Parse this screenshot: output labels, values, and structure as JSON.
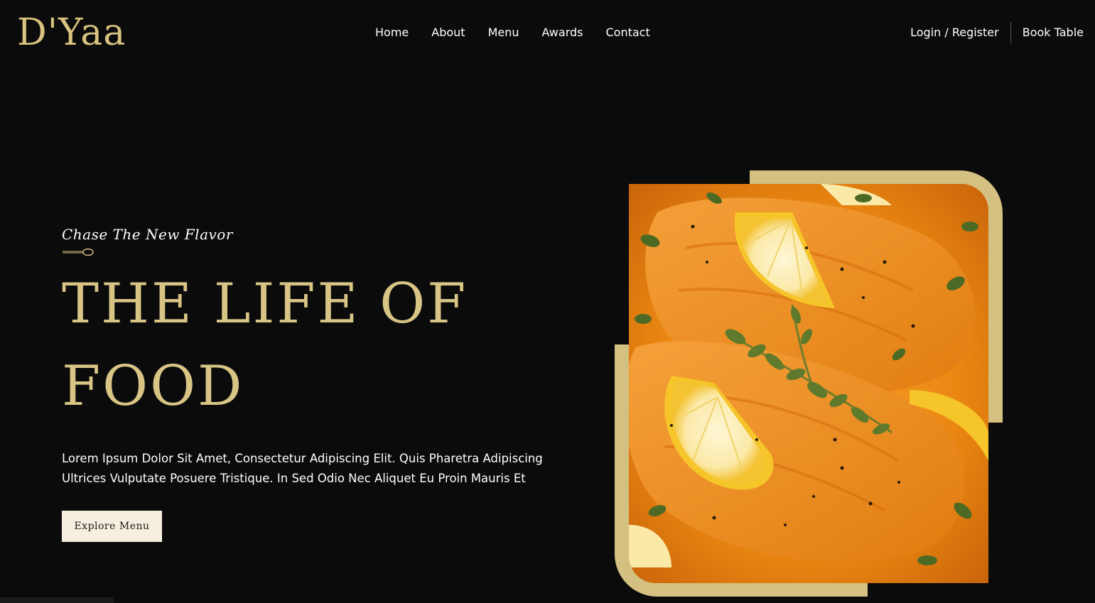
{
  "brand": {
    "logo": "D'Yaa"
  },
  "nav": {
    "items": [
      "Home",
      "About",
      "Menu",
      "Awards",
      "Contact"
    ],
    "login": "Login / Register",
    "book": "Book Table"
  },
  "hero": {
    "tagline": "Chase The New Flavor",
    "headline_line1": "THE LIFE OF",
    "headline_line2": "FOOD",
    "description_line1": "Lorem Ipsum Dolor Sit Amet, Consectetur Adipiscing Elit. Quis Pharetra Adipiscing",
    "description_line2": "Ultrices Vulputate Posuere Tristique. In Sed Odio Nec Aliquet Eu Proin Mauris Et",
    "cta_label": "Explore Menu"
  },
  "colors": {
    "background": "#0b0b0c",
    "accent_gold": "#d8c27e",
    "button_bg": "#f6efdf",
    "food_orange": "#e8860f"
  },
  "icons": [
    "spoon-icon"
  ]
}
